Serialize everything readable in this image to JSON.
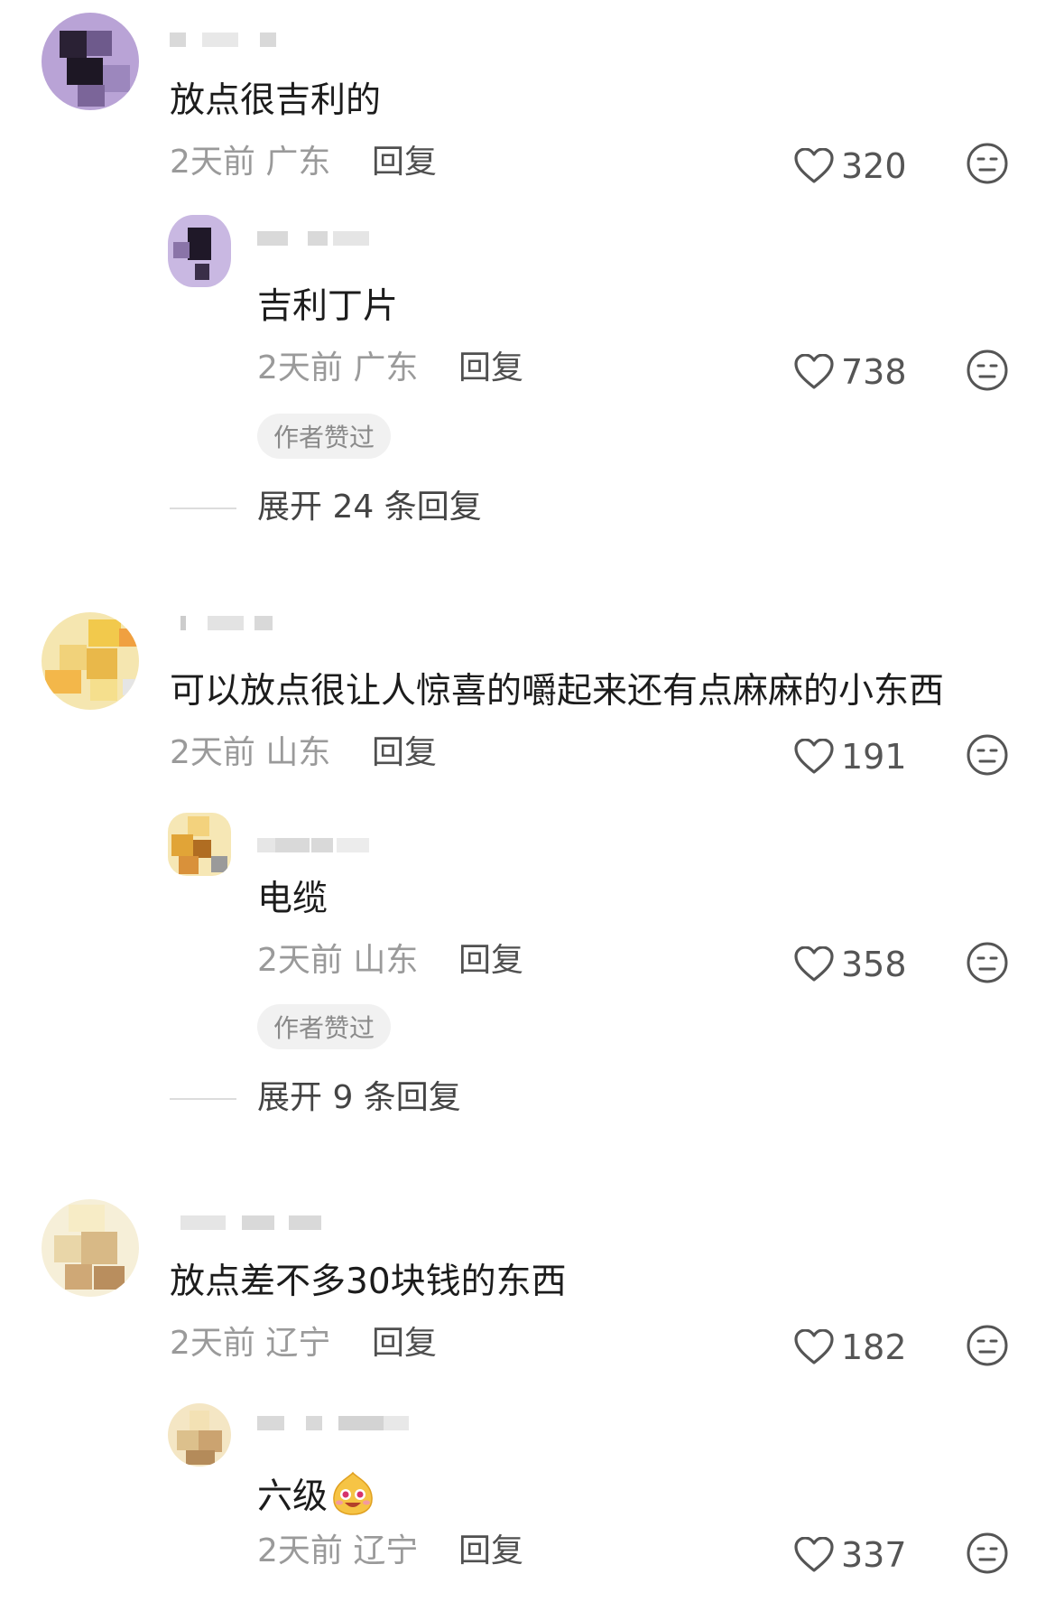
{
  "comments": [
    {
      "text": "放点很吉利的",
      "time": "2天前",
      "location": "广东",
      "reply_label": "回复",
      "likes": "320",
      "replies": [
        {
          "text": "吉利丁片",
          "time": "2天前",
          "location": "广东",
          "reply_label": "回复",
          "likes": "738",
          "badge": "作者赞过"
        }
      ],
      "expand_label": "展开 24 条回复"
    },
    {
      "text": "可以放点很让人惊喜的嚼起来还有点麻麻的小东西",
      "time": "2天前",
      "location": "山东",
      "reply_label": "回复",
      "likes": "191",
      "replies": [
        {
          "text": "电缆",
          "time": "2天前",
          "location": "山东",
          "reply_label": "回复",
          "likes": "358",
          "badge": "作者赞过"
        }
      ],
      "expand_label": "展开 9 条回复"
    },
    {
      "text": "放点差不多30块钱的东西",
      "time": "2天前",
      "location": "辽宁",
      "reply_label": "回复",
      "likes": "182",
      "replies": [
        {
          "text": "六级",
          "emoji": "smiling-face-emoji",
          "time": "2天前",
          "location": "辽宁",
          "reply_label": "回复",
          "likes": "337"
        }
      ]
    }
  ],
  "colors": {
    "text": "#1c1c1c",
    "meta": "#9a9a9a",
    "badge_bg": "#f1f1f1",
    "icon": "#555555"
  },
  "icons": {
    "like": "heart-icon",
    "dislike": "dislike-face-icon"
  }
}
